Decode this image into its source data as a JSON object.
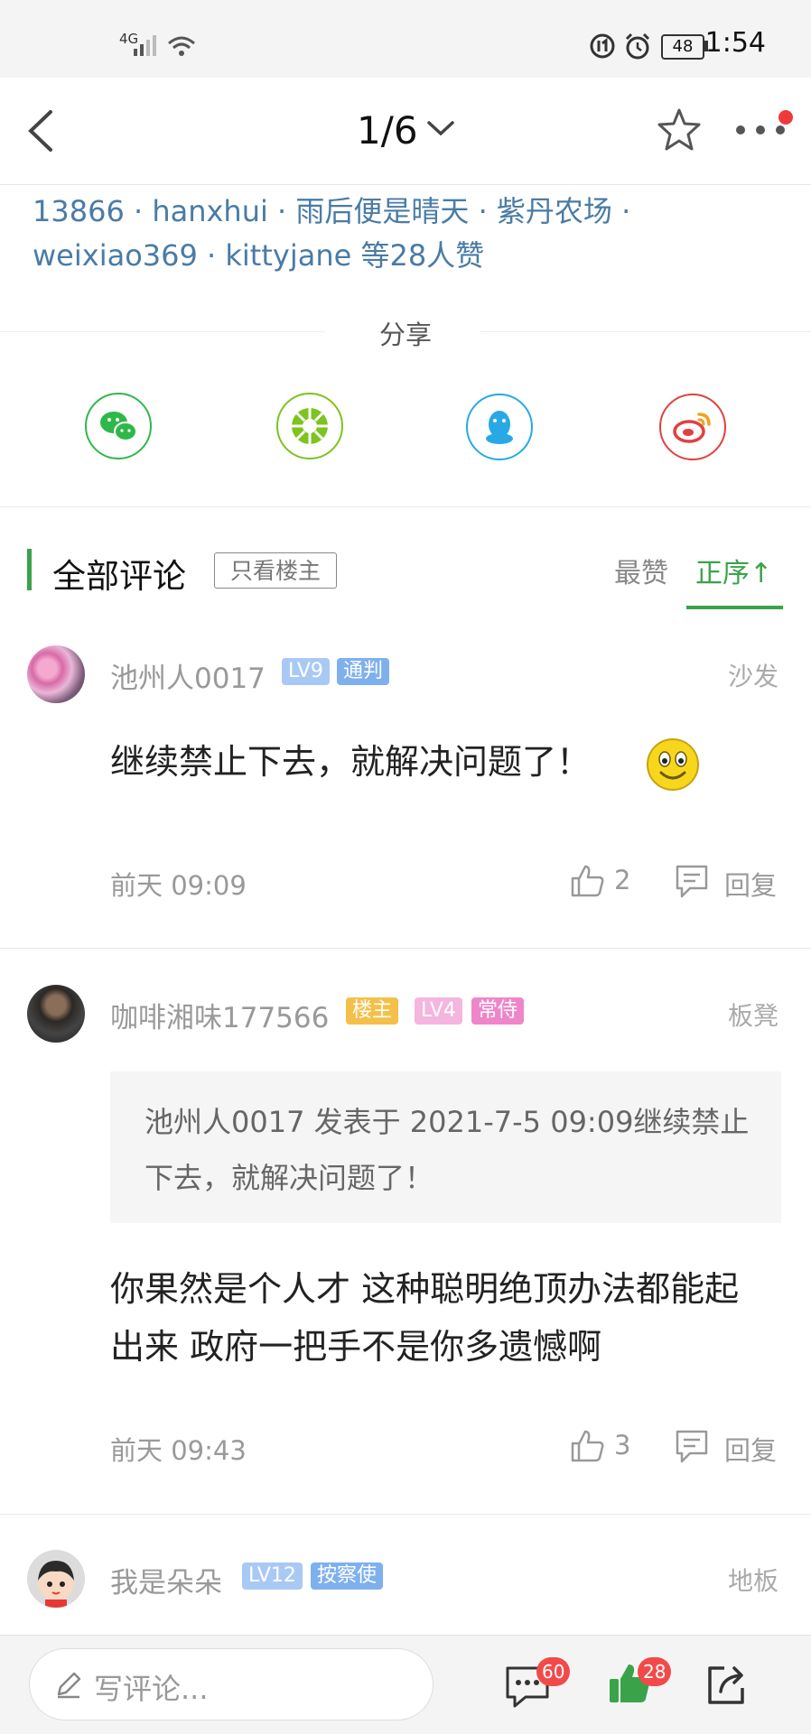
{
  "status_bar": {
    "network": "4G",
    "battery": "48",
    "time": "1:54"
  },
  "nav": {
    "page_indicator": "1/6"
  },
  "likers_text": "13866 · hanxhui · 雨后便是晴天 · 紫丹农场 · weixiao369 · kittyjane 等28人赞",
  "share": {
    "label": "分享",
    "buttons": [
      {
        "name": "wechat",
        "icon": "wechat-icon",
        "color": "#2fb84a"
      },
      {
        "name": "moments",
        "icon": "moments-icon",
        "color": "#7cc41f"
      },
      {
        "name": "qq",
        "icon": "qq-icon",
        "color": "#28a9e6"
      },
      {
        "name": "weibo",
        "icon": "weibo-icon",
        "color": "#e2403f"
      }
    ]
  },
  "comments_header": {
    "title": "全部评论",
    "owner_only": "只看楼主",
    "sort_hot": "最赞",
    "sort_asc": "正序↑",
    "accent": "#3aa34a"
  },
  "comments": [
    {
      "user": "池州人0017",
      "badges": [
        {
          "text": "LV9",
          "color": "#a9c9f5"
        },
        {
          "text": "通判",
          "color": "#7fb0ee"
        }
      ],
      "floor": "沙发",
      "body": "继续禁止下去，就解决问题了！",
      "emoji": "smile-emoji",
      "time": "前天 09:09",
      "likes": "2",
      "reply": "回复"
    },
    {
      "user": "咖啡湘味177566",
      "badges": [
        {
          "text": "楼主",
          "color": "#f5c049"
        },
        {
          "text": "LV4",
          "color": "#f4b5df"
        },
        {
          "text": "常侍",
          "color": "#ee86c9"
        }
      ],
      "floor": "板凳",
      "quote": "池州人0017 发表于 2021-7-5 09:09继续禁止下去，就解决问题了！",
      "body": "你果然是个人才 这种聪明绝顶办法都能起出来  政府一把手不是你多遗憾啊",
      "time": "前天 09:43",
      "likes": "3",
      "reply": "回复"
    },
    {
      "user": "我是朵朵",
      "badges": [
        {
          "text": "LV12",
          "color": "#a9c9f5"
        },
        {
          "text": "按察使",
          "color": "#7fb0ee"
        }
      ],
      "floor": "地板"
    }
  ],
  "bottom_bar": {
    "placeholder": "写评论...",
    "comment_count": "60",
    "like_count": "28"
  }
}
